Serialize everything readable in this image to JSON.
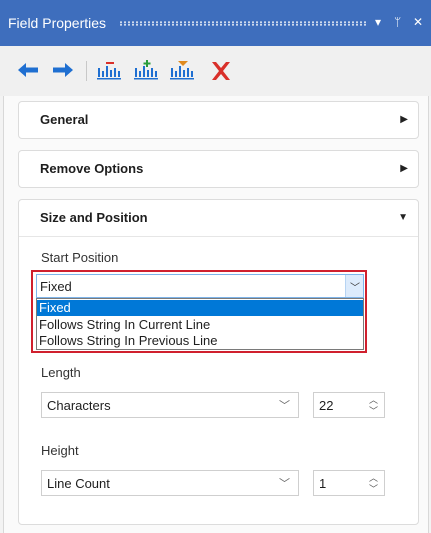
{
  "titlebar": {
    "title": "Field Properties",
    "buttons": [
      {
        "name": "dropdown-arrow-icon",
        "glyph": "▾"
      },
      {
        "name": "pin-icon",
        "glyph": "ᛘ"
      },
      {
        "name": "close-icon",
        "glyph": "✕"
      }
    ]
  },
  "toolbar": {
    "tools": [
      {
        "name": "back-arrow-icon",
        "color": "#1f6fd1"
      },
      {
        "name": "forward-arrow-icon",
        "color": "#1f6fd1"
      },
      {
        "name": "field-remove-icon",
        "color": "#1f6fd1"
      },
      {
        "name": "field-add-icon",
        "color": "#1f6fd1"
      },
      {
        "name": "field-insert-icon",
        "color": "#1f6fd1"
      },
      {
        "name": "delete-x-icon",
        "color": "#d9302a"
      }
    ]
  },
  "sections": {
    "general": {
      "title": "General",
      "arrow": "▶"
    },
    "remove_options": {
      "title": "Remove Options",
      "arrow": "▶"
    },
    "size_position": {
      "title": "Size and Position",
      "arrow": "▼",
      "start_position": {
        "label": "Start Position",
        "value": "Fixed",
        "chevron": "﹀",
        "options": [
          "Fixed",
          "Follows String In Current Line",
          "Follows String In Previous Line"
        ]
      },
      "length": {
        "label": "Length",
        "unit": "Characters",
        "chevron": "﹀",
        "value": "22",
        "up": "︿",
        "down": "﹀"
      },
      "height": {
        "label": "Height",
        "unit": "Line Count",
        "chevron": "﹀",
        "value": "1",
        "up": "︿",
        "down": "﹀"
      }
    }
  },
  "colors": {
    "accent": "#3e6ebd",
    "selection": "#0078d7",
    "highlight": "#d0202e"
  }
}
